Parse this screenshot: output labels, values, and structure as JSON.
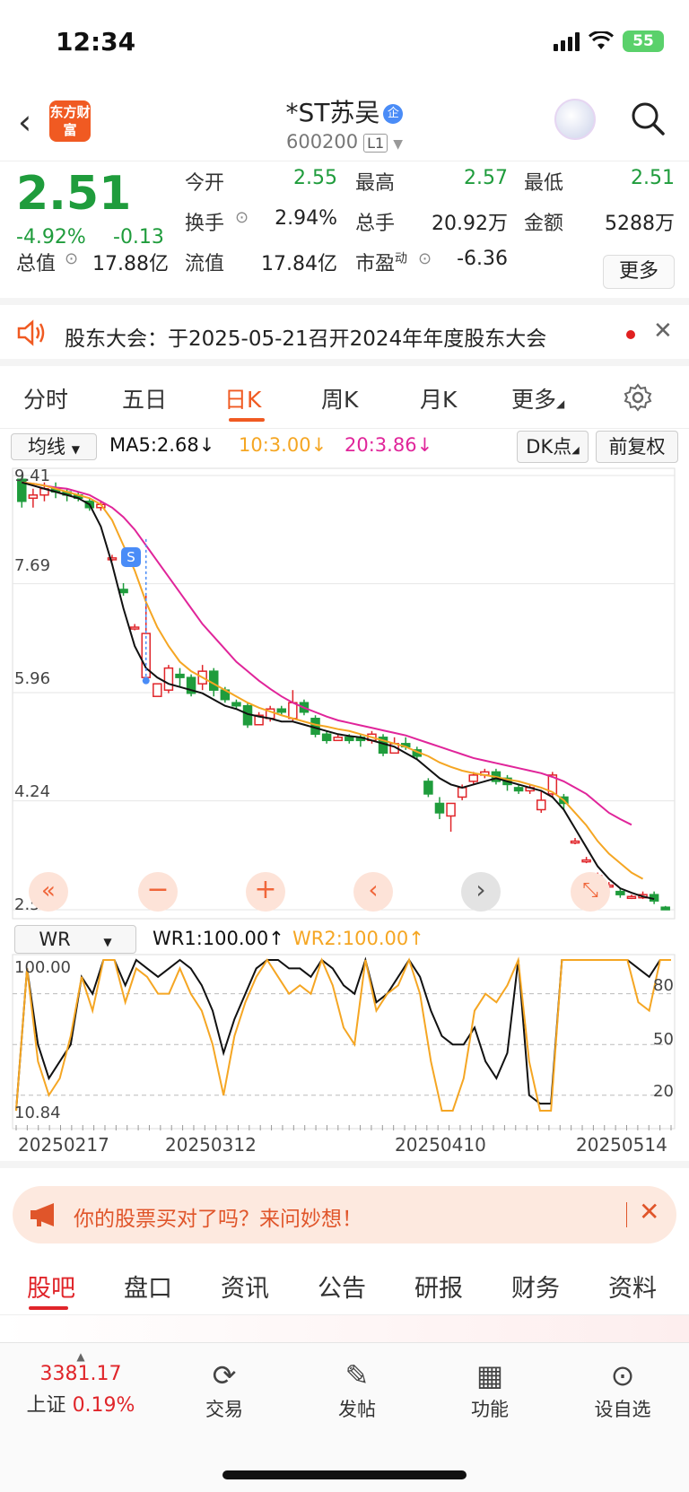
{
  "status": {
    "time": "12:34",
    "battery": "55"
  },
  "header": {
    "back_icon": "chevron-left-icon",
    "logo_text": "东方财富",
    "title": "*ST苏吴",
    "badge": "企",
    "code": "600200",
    "level": "L1"
  },
  "quote": {
    "price": "2.51",
    "pct": "-4.92%",
    "chg": "-0.13",
    "open_label": "今开",
    "open": "2.55",
    "high_label": "最高",
    "high": "2.57",
    "low_label": "最低",
    "low": "2.51",
    "turnover_label": "换手",
    "turnover": "2.94%",
    "volume_label": "总手",
    "volume": "20.92万",
    "amount_label": "金额",
    "amount": "5288万",
    "mktcap_label": "总值",
    "mktcap": "17.88亿",
    "float_label": "流值",
    "float": "17.84亿",
    "pe_label": "市盈",
    "pe_sup": "动",
    "pe": "-6.36",
    "more": "更多"
  },
  "notice": {
    "text": "股东大会：于2025-05-21召开2024年年度股东大会"
  },
  "tabs": [
    {
      "label": "分时"
    },
    {
      "label": "五日"
    },
    {
      "label": "日K"
    },
    {
      "label": "周K"
    },
    {
      "label": "月K"
    },
    {
      "label": "更多"
    }
  ],
  "ma": {
    "type": "均线",
    "ma5": "MA5:2.68",
    "ma10": "10:3.00",
    "ma20": "20:3.86",
    "dk": "DK点",
    "fq": "前复权"
  },
  "chart_labels": {
    "p1": "9.41",
    "p2": "7.69",
    "p3": "5.96",
    "p4": "4.24",
    "p5": "2.51",
    "s_marker": "S"
  },
  "wr": {
    "type": "WR",
    "wr1": "WR1:100.00",
    "wr2": "WR2:100.00",
    "top": "100.00",
    "bottom": "10.84",
    "l80": "80",
    "l50": "50",
    "l20": "20"
  },
  "dates": [
    "20250217",
    "20250312",
    "20250410",
    "20250514"
  ],
  "ad": {
    "text": "你的股票买对了吗？来问妙想！"
  },
  "bottom_tabs": [
    {
      "label": "股吧"
    },
    {
      "label": "盘口"
    },
    {
      "label": "资讯"
    },
    {
      "label": "公告"
    },
    {
      "label": "研报"
    },
    {
      "label": "财务"
    },
    {
      "label": "资料"
    }
  ],
  "bottombar": {
    "index_value": "3381.17",
    "index_name": "上证",
    "index_pct": "0.19%",
    "trade": "交易",
    "post": "发帖",
    "func": "功能",
    "watch": "设自选"
  },
  "colors": {
    "up": "#e0252a",
    "down": "#1f9c3c",
    "accent": "#f05a22",
    "ma5": "#111111",
    "ma10": "#f5a623",
    "ma20": "#e0259a"
  },
  "chart_data": {
    "type": "candlestick",
    "y_range": [
      2.51,
      9.41
    ],
    "ticks": [
      9.41,
      7.69,
      5.96,
      4.24,
      2.51
    ],
    "candles": [
      [
        9.35,
        9.0,
        9.4,
        8.9
      ],
      [
        9.05,
        9.1,
        9.2,
        8.9
      ],
      [
        9.1,
        9.2,
        9.3,
        9.0
      ],
      [
        9.2,
        9.15,
        9.3,
        9.05
      ],
      [
        9.15,
        9.1,
        9.2,
        9.0
      ],
      [
        9.1,
        9.05,
        9.15,
        9.0
      ],
      [
        9.0,
        8.9,
        9.05,
        8.85
      ],
      [
        8.9,
        8.95,
        9.0,
        8.85
      ],
      [
        8.1,
        8.1,
        8.15,
        8.05
      ],
      [
        7.6,
        7.55,
        7.7,
        7.5
      ],
      [
        7.0,
        7.0,
        7.05,
        6.95
      ],
      [
        6.2,
        6.9,
        7.5,
        6.1
      ],
      [
        5.9,
        6.1,
        6.1,
        5.9
      ],
      [
        6.0,
        6.35,
        6.4,
        5.95
      ],
      [
        6.25,
        6.2,
        6.35,
        6.05
      ],
      [
        6.2,
        5.95,
        6.25,
        5.9
      ],
      [
        6.1,
        6.3,
        6.4,
        6.0
      ],
      [
        6.3,
        6.0,
        6.35,
        5.9
      ],
      [
        6.0,
        5.85,
        6.05,
        5.8
      ],
      [
        5.8,
        5.75,
        5.85,
        5.7
      ],
      [
        5.75,
        5.45,
        5.8,
        5.4
      ],
      [
        5.45,
        5.6,
        5.65,
        5.45
      ],
      [
        5.55,
        5.7,
        5.75,
        5.5
      ],
      [
        5.7,
        5.65,
        5.75,
        5.6
      ],
      [
        5.55,
        5.8,
        6.0,
        5.5
      ],
      [
        5.8,
        5.65,
        5.85,
        5.6
      ],
      [
        5.55,
        5.3,
        5.6,
        5.25
      ],
      [
        5.3,
        5.2,
        5.35,
        5.15
      ],
      [
        5.2,
        5.25,
        5.3,
        5.2
      ],
      [
        5.25,
        5.2,
        5.3,
        5.15
      ],
      [
        5.25,
        5.2,
        5.3,
        5.1
      ],
      [
        5.2,
        5.3,
        5.35,
        5.15
      ],
      [
        5.25,
        5.0,
        5.3,
        4.95
      ],
      [
        5.0,
        5.15,
        5.25,
        5.0
      ],
      [
        5.15,
        5.1,
        5.25,
        5.05
      ],
      [
        5.05,
        4.95,
        5.1,
        4.9
      ],
      [
        4.55,
        4.35,
        4.6,
        4.3
      ],
      [
        4.2,
        4.05,
        4.3,
        3.95
      ],
      [
        4.0,
        4.2,
        4.2,
        3.75
      ],
      [
        4.3,
        4.45,
        4.5,
        4.25
      ],
      [
        4.55,
        4.65,
        4.7,
        4.5
      ],
      [
        4.65,
        4.7,
        4.75,
        4.6
      ],
      [
        4.7,
        4.55,
        4.75,
        4.5
      ],
      [
        4.6,
        4.5,
        4.65,
        4.4
      ],
      [
        4.45,
        4.4,
        4.5,
        4.35
      ],
      [
        4.4,
        4.45,
        4.5,
        4.35
      ],
      [
        4.1,
        4.25,
        4.4,
        4.05
      ],
      [
        4.35,
        4.65,
        4.7,
        4.3
      ],
      [
        4.3,
        4.2,
        4.35,
        4.1
      ],
      [
        3.6,
        3.6,
        3.65,
        3.55
      ],
      [
        3.3,
        3.3,
        3.35,
        3.25
      ],
      [
        3.05,
        3.05,
        3.1,
        3.0
      ],
      [
        2.9,
        2.9,
        2.95,
        2.85
      ],
      [
        2.8,
        2.75,
        2.85,
        2.7
      ],
      [
        2.7,
        2.72,
        2.75,
        2.68
      ],
      [
        2.7,
        2.75,
        2.8,
        2.68
      ],
      [
        2.75,
        2.65,
        2.8,
        2.6
      ],
      [
        2.55,
        2.51,
        2.57,
        2.51
      ]
    ],
    "ma5": [
      9.3,
      9.25,
      9.2,
      9.15,
      9.1,
      9.05,
      8.95,
      8.6,
      8.0,
      7.3,
      6.7,
      6.35,
      6.2,
      6.1,
      6.05,
      6.0,
      5.95,
      5.85,
      5.75,
      5.7,
      5.62,
      5.58,
      5.55,
      5.5,
      5.5,
      5.45,
      5.4,
      5.35,
      5.3,
      5.27,
      5.25,
      5.2,
      5.15,
      5.1,
      5.0,
      4.9,
      4.75,
      4.6,
      4.5,
      4.45,
      4.5,
      4.55,
      4.6,
      4.55,
      4.5,
      4.45,
      4.4,
      4.3,
      4.1,
      3.8,
      3.5,
      3.2,
      3.0,
      2.85,
      2.78,
      2.72,
      2.68
    ],
    "ma10": [
      9.3,
      9.28,
      9.25,
      9.2,
      9.15,
      9.1,
      9.05,
      8.95,
      8.7,
      8.3,
      7.9,
      7.4,
      7.0,
      6.7,
      6.45,
      6.3,
      6.2,
      6.1,
      6.0,
      5.9,
      5.8,
      5.72,
      5.66,
      5.6,
      5.55,
      5.5,
      5.45,
      5.42,
      5.38,
      5.35,
      5.3,
      5.25,
      5.2,
      5.15,
      5.1,
      5.02,
      4.95,
      4.85,
      4.78,
      4.72,
      4.68,
      4.65,
      4.62,
      4.58,
      4.55,
      4.5,
      4.45,
      4.38,
      4.25,
      4.05,
      3.85,
      3.6,
      3.4,
      3.25,
      3.1,
      3.0
    ],
    "ma20": [
      9.3,
      9.28,
      9.25,
      9.22,
      9.2,
      9.15,
      9.1,
      9.0,
      8.9,
      8.75,
      8.55,
      8.3,
      8.05,
      7.8,
      7.55,
      7.3,
      7.05,
      6.85,
      6.65,
      6.45,
      6.3,
      6.15,
      6.02,
      5.9,
      5.8,
      5.72,
      5.65,
      5.58,
      5.52,
      5.48,
      5.44,
      5.4,
      5.36,
      5.32,
      5.28,
      5.22,
      5.16,
      5.1,
      5.04,
      4.98,
      4.92,
      4.88,
      4.84,
      4.8,
      4.76,
      4.72,
      4.68,
      4.62,
      4.55,
      4.45,
      4.35,
      4.2,
      4.05,
      3.95,
      3.86
    ],
    "wr1": [
      10,
      95,
      50,
      30,
      40,
      50,
      90,
      80,
      100,
      100,
      85,
      100,
      95,
      90,
      95,
      100,
      95,
      85,
      70,
      45,
      65,
      80,
      95,
      100,
      100,
      95,
      95,
      90,
      100,
      95,
      85,
      80,
      100,
      75,
      80,
      90,
      100,
      90,
      70,
      55,
      50,
      50,
      60,
      40,
      30,
      45,
      100,
      20,
      15,
      15,
      100,
      100,
      100,
      100,
      100,
      100,
      100,
      95,
      90,
      100,
      100
    ],
    "wr2": [
      10,
      95,
      40,
      20,
      30,
      55,
      90,
      70,
      100,
      100,
      75,
      95,
      90,
      80,
      80,
      95,
      80,
      70,
      50,
      20,
      55,
      75,
      90,
      100,
      90,
      80,
      85,
      80,
      100,
      85,
      60,
      50,
      100,
      70,
      80,
      85,
      100,
      80,
      40,
      10,
      5,
      30,
      70,
      80,
      75,
      85,
      100,
      40,
      10,
      10,
      100,
      100,
      100,
      100,
      100,
      100,
      100,
      75,
      70,
      100,
      100
    ]
  }
}
